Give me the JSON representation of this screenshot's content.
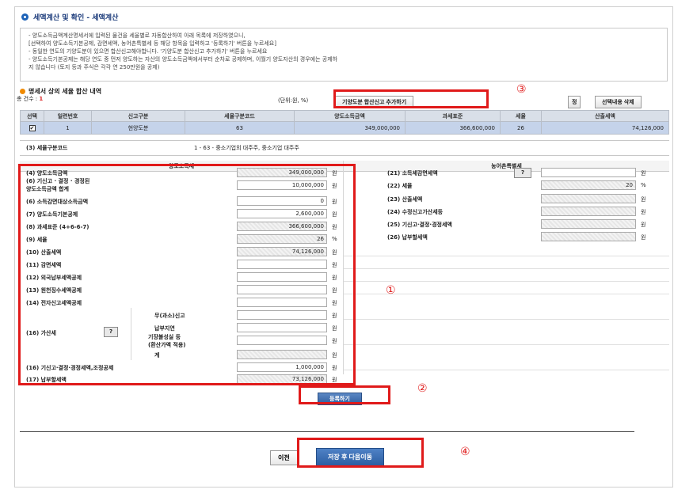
{
  "header": {
    "title": "세액계산 및 확인 - 세액계산"
  },
  "notice": {
    "lines": [
      "- 양도소득금액계산명세서에 입력된 물건을 세율별로 자동합산하여 아래 목록에 저장하였으니,",
      "  [선택하여 양도소득기본공제, 감면세액, 농어촌특별세 등 해당 항목을 입력하고 '등록하기' 버튼을 누르세요]",
      "- 동일한 연도의 기양도분이 있으면 합산신고해야합니다. '기양도분 합산신고 추가하기' 버튼을 누르세요",
      "- 양도소득기본공제는 해당 연도 중 먼저 양도하는 자산의 양도소득금액에서부터 순차로 공제하며, 이월기 양도자산의 경우에는 공제하",
      "  지 않습니다 (토지 등과 주식은 각각 연 250만원을 공제)"
    ]
  },
  "detail": {
    "title": "명세서 상의 세율 합산 내역",
    "count_label": "총 건수 :",
    "count": "1",
    "unit": "(단위:원, %)",
    "add_button": "기양도분 합산신고 추가하기",
    "fix_button": "정",
    "delete_button": "선택내용 삭제"
  },
  "table": {
    "headers": [
      "선택",
      "일련번호",
      "신고구분",
      "세율구분코드",
      "양도소득금액",
      "과세표준",
      "세율",
      "산출세액"
    ],
    "row": {
      "check": "✔",
      "no": "1",
      "type": "현양도분",
      "code": "63",
      "income": "349,000,000",
      "base": "366,600,000",
      "rate": "26",
      "tax": "74,126,000"
    }
  },
  "code_row": {
    "label": "(3) 세율구분코드",
    "value": "1 - 63 - 중소기업외 대주주, 중소기업 대주주"
  },
  "left": {
    "header": "양도소득세",
    "items": [
      {
        "label": "(4) 양도소득금액",
        "value": "349,000,000",
        "unit": "원"
      },
      {
        "label": "(6) 기신고 · 결정 · 경정된",
        "label2": "양도소득금액 합계",
        "value": "10,000,000",
        "unit": "원"
      },
      {
        "label": "(6) 소득감면대상소득금액",
        "value": "0",
        "unit": "원"
      },
      {
        "label": "(7) 양도소득기본공제",
        "value": "2,600,000",
        "unit": "원"
      },
      {
        "label": "(8) 과세표준 (4+6-6-7)",
        "value": "366,600,000",
        "unit": "원"
      },
      {
        "label": "(9) 세율",
        "value": "26",
        "unit": "%"
      },
      {
        "label": "(10) 산출세액",
        "value": "74,126,000",
        "unit": "원"
      },
      {
        "label": "(11) 감면세액",
        "value": "",
        "unit": "원"
      },
      {
        "label": "(12) 외국납부세액공제",
        "value": "",
        "unit": "원"
      },
      {
        "label": "(13) 원천징수세액공제",
        "value": "",
        "unit": "원"
      },
      {
        "label": "(14) 전자신고세액공제",
        "value": "",
        "unit": "원"
      }
    ],
    "penalty": {
      "label": "(16) 가산세",
      "q": "?",
      "subs": [
        {
          "label": "무(과소)신고",
          "unit": "원"
        },
        {
          "label": "납부지연",
          "unit": "원"
        },
        {
          "label": "기장불성실 등",
          "label2": "(환산가액 적용)",
          "unit": "원"
        },
        {
          "label": "계",
          "unit": "원"
        }
      ]
    },
    "items2": [
      {
        "label": "(16) 기신고·결정·경정세액,조정공제",
        "value": "1,000,000",
        "unit": "원"
      },
      {
        "label": "(17) 납부할세액",
        "value": "73,126,000",
        "unit": "원"
      }
    ],
    "register_button": "등록하기"
  },
  "right": {
    "header": "농어촌특별세",
    "items": [
      {
        "label": "(21) 소득세감면세액",
        "q": "?",
        "value": "",
        "unit": "원"
      },
      {
        "label": "(22) 세율",
        "value": "20",
        "unit": "%"
      },
      {
        "label": "(23) 산출세액",
        "value": "",
        "unit": "원"
      },
      {
        "label": "(24) 수정신고가산세등",
        "value": "",
        "unit": "원"
      },
      {
        "label": "(25) 기신고·결정·경정세액",
        "value": "",
        "unit": "원"
      },
      {
        "label": "(26) 납부할세액",
        "value": "",
        "unit": "원"
      }
    ]
  },
  "footer": {
    "prev_button": "이전",
    "next_button": "저장 후 다음이동"
  },
  "markers": {
    "m1": "①",
    "m2": "②",
    "m3": "③",
    "m4": "④"
  },
  "colors": {
    "highlight": "#e01a1a",
    "row_selected": "#c5d3ea",
    "primary_button": "#2f5e9e"
  }
}
